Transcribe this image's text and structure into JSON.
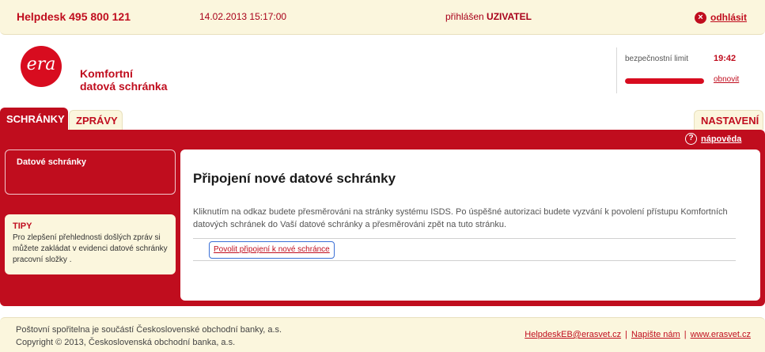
{
  "topbar": {
    "helpdesk": "Helpdesk 495 800 121",
    "datetime": "14.02.2013 15:17:00",
    "logged_in_label": "přihlášen",
    "logged_in_user": "UZIVATEL",
    "logout_label": "odhlásit",
    "logout_icon": "close-circle-icon"
  },
  "header": {
    "logo_text": "era",
    "brand_line1": "Komfortní",
    "brand_line2": "datová schránka",
    "session_label": "bezpečnostní limit",
    "session_time": "19:42",
    "session_progress": 1.0,
    "refresh_label": "obnovit"
  },
  "tabs": {
    "active": "SCHRÁNKY",
    "second": "ZPRÁVY",
    "settings": "NASTAVENÍ"
  },
  "help": {
    "icon": "question-circle-icon",
    "label": "nápověda"
  },
  "sidebar": {
    "box_title": "Datové schránky",
    "tips_title": "TIPY",
    "tips_text": "Pro zlepšení přehlednosti došlých zpráv si můžete zakládat v evidenci datové schránky pracovní složky ."
  },
  "content": {
    "title": "Připojení nové datové schránky",
    "description": "Kliknutím na odkaz budete přesměrováni na stránky systému ISDS. Po úspěšné autorizaci budete vyzvání k povolení přístupu Komfortních datových schránek do Vaší datové schránky a přesměrováni zpět na tuto stránku.",
    "link_label": "Povolit připojení k nové schránce"
  },
  "footer": {
    "line1": "Poštovní spořitelna je součástí Československé obchodní banky, a.s.",
    "line2": "Copyright © 2013, Československá obchodní banka, a.s.",
    "link_email": "HelpdeskEB@erasvet.cz",
    "link_write": "Napište nám",
    "link_web": "www.erasvet.cz",
    "separator": "|"
  },
  "colors": {
    "brand_red": "#c00d1e",
    "cream": "#fbf6dd",
    "link_border": "#3b6fd6"
  }
}
